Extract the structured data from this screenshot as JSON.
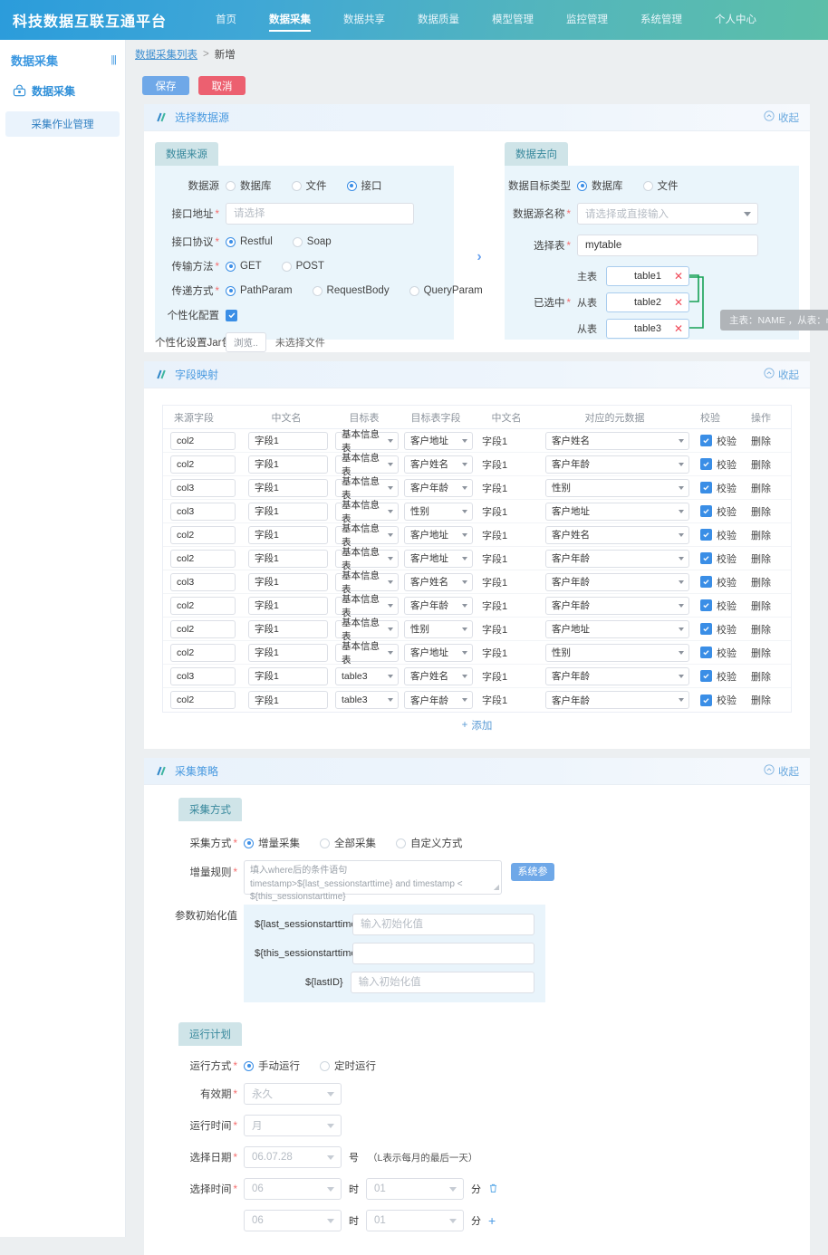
{
  "app": {
    "brand": "科技数据互联互通平台",
    "nav": [
      {
        "label": "首页",
        "active": false
      },
      {
        "label": "数据采集",
        "active": true
      },
      {
        "label": "数据共享",
        "active": false
      },
      {
        "label": "数据质量",
        "active": false
      },
      {
        "label": "模型管理",
        "active": false
      },
      {
        "label": "监控管理",
        "active": false
      },
      {
        "label": "系统管理",
        "active": false
      },
      {
        "label": "个人中心",
        "active": false
      }
    ]
  },
  "sidebar": {
    "title": "数据采集",
    "collapse_icon": "columns-icon",
    "group_label": "数据采集",
    "group_icon": "collect-icon",
    "items": [
      {
        "label": "采集作业管理",
        "active": true
      }
    ]
  },
  "breadcrumb": {
    "link": "数据采集列表",
    "sep": ">",
    "current": "新增"
  },
  "actions": {
    "save": "保存",
    "cancel": "取消"
  },
  "sections": {
    "datasource": {
      "title": "选择数据源",
      "collapse": "收起"
    },
    "mapping": {
      "title": "字段映射",
      "collapse": "收起"
    },
    "strategy": {
      "title": "采集策略",
      "collapse": "收起"
    }
  },
  "source_panel": {
    "tab": "数据来源",
    "datasource_label": "数据源",
    "datasource_options": [
      {
        "label": "数据库",
        "selected": false
      },
      {
        "label": "文件",
        "selected": false
      },
      {
        "label": "接口",
        "selected": true
      }
    ],
    "api_url_label": "接口地址",
    "api_url_placeholder": "请选择",
    "api_url_value": "",
    "protocol_label": "接口协议",
    "protocol_options": [
      {
        "label": "Restful",
        "selected": true
      },
      {
        "label": "Soap",
        "selected": false
      }
    ],
    "method_label": "传输方法",
    "method_options": [
      {
        "label": "GET",
        "selected": true
      },
      {
        "label": "POST",
        "selected": false
      }
    ],
    "transfer_label": "传递方式",
    "transfer_options": [
      {
        "label": "PathParam",
        "selected": true
      },
      {
        "label": "RequestBody",
        "selected": false
      },
      {
        "label": "QueryParam",
        "selected": false
      }
    ],
    "custom_label": "个性化配置",
    "custom_checked": true,
    "jar_label": "个性化设置Jar包",
    "jar_browse": "浏览..",
    "jar_status": "未选择文件"
  },
  "arrow": "›",
  "target_panel": {
    "tab": "数据去向",
    "type_label": "数据目标类型",
    "type_options": [
      {
        "label": "数据库",
        "selected": true
      },
      {
        "label": "文件",
        "selected": false
      }
    ],
    "ds_name_label": "数据源名称",
    "ds_name_placeholder": "请选择或直接输入",
    "ds_name_value": "",
    "table_label": "选择表",
    "table_value": "mytable",
    "selected_label": "已选中",
    "rows": [
      {
        "role": "主表",
        "name": "table1",
        "remove": "✕"
      },
      {
        "role": "从表",
        "name": "table2",
        "remove": "✕"
      },
      {
        "role": "从表",
        "name": "table3",
        "remove": "✕"
      }
    ],
    "tooltip": "主表：NAME ，从表：name",
    "connector_color": "#17a255"
  },
  "mapping_table": {
    "headers": [
      "来源字段",
      "中文名",
      "目标表",
      "目标表字段",
      "中文名",
      "对应的元数据",
      "校验",
      "操作"
    ],
    "verify_label": "校验",
    "delete_label": "删除",
    "add_label": "添加",
    "rows": [
      {
        "src": "col2",
        "cn1": "字段1",
        "tgt_table": "基本信息表",
        "tgt_field": "客户地址",
        "cn2": "字段1",
        "meta": "客户姓名",
        "verify": true
      },
      {
        "src": "col2",
        "cn1": "字段1",
        "tgt_table": "基本信息表",
        "tgt_field": "客户姓名",
        "cn2": "字段1",
        "meta": "客户年龄",
        "verify": true
      },
      {
        "src": "col3",
        "cn1": "字段1",
        "tgt_table": "基本信息表",
        "tgt_field": "客户年龄",
        "cn2": "字段1",
        "meta": "性别",
        "verify": true
      },
      {
        "src": "col3",
        "cn1": "字段1",
        "tgt_table": "基本信息表",
        "tgt_field": "性别",
        "cn2": "字段1",
        "meta": "客户地址",
        "verify": true
      },
      {
        "src": "col2",
        "cn1": "字段1",
        "tgt_table": "基本信息表",
        "tgt_field": "客户地址",
        "cn2": "字段1",
        "meta": "客户姓名",
        "verify": true
      },
      {
        "src": "col2",
        "cn1": "字段1",
        "tgt_table": "基本信息表",
        "tgt_field": "客户地址",
        "cn2": "字段1",
        "meta": "客户年龄",
        "verify": true
      },
      {
        "src": "col3",
        "cn1": "字段1",
        "tgt_table": "基本信息表",
        "tgt_field": "客户姓名",
        "cn2": "字段1",
        "meta": "客户年龄",
        "verify": true
      },
      {
        "src": "col2",
        "cn1": "字段1",
        "tgt_table": "基本信息表",
        "tgt_field": "客户年龄",
        "cn2": "字段1",
        "meta": "客户年龄",
        "verify": true
      },
      {
        "src": "col2",
        "cn1": "字段1",
        "tgt_table": "基本信息表",
        "tgt_field": "性别",
        "cn2": "字段1",
        "meta": "客户地址",
        "verify": true
      },
      {
        "src": "col2",
        "cn1": "字段1",
        "tgt_table": "基本信息表",
        "tgt_field": "客户地址",
        "cn2": "字段1",
        "meta": "性别",
        "verify": true
      },
      {
        "src": "col3",
        "cn1": "字段1",
        "tgt_table": "table3",
        "tgt_field": "客户姓名",
        "cn2": "字段1",
        "meta": "客户年龄",
        "verify": true
      },
      {
        "src": "col2",
        "cn1": "字段1",
        "tgt_table": "table3",
        "tgt_field": "客户年龄",
        "cn2": "字段1",
        "meta": "客户年龄",
        "verify": true
      }
    ]
  },
  "strategy": {
    "tab": "采集方式",
    "mode_label": "采集方式",
    "mode_options": [
      {
        "label": "增量采集",
        "selected": true
      },
      {
        "label": "全部采集",
        "selected": false
      },
      {
        "label": "自定义方式",
        "selected": false
      }
    ],
    "rule_label": "增量规则",
    "rule_line1": "填入where后的条件语句",
    "rule_line2": "timestamp>${last_sessionstarttime} and timestamp  <  ${this_sessionstarttime}",
    "sys_param_btn": "系统参数",
    "params_label": "参数初始化值",
    "params": [
      {
        "name": "${last_sessionstarttime}",
        "placeholder": "输入初始化值",
        "value": ""
      },
      {
        "name": "${this_sessionstarttime}",
        "placeholder": "",
        "value": ""
      },
      {
        "name": "${lastID}",
        "placeholder": "输入初始化值",
        "value": ""
      }
    ]
  },
  "plan": {
    "tab": "运行计划",
    "run_mode_label": "运行方式",
    "run_mode_options": [
      {
        "label": "手动运行",
        "selected": true
      },
      {
        "label": "定时运行",
        "selected": false
      }
    ],
    "validity_label": "有效期",
    "validity_value": "永久",
    "run_time_label": "运行时间",
    "run_time_value": "月",
    "date_label": "选择日期",
    "date_value": "06.07.28",
    "date_unit": "号",
    "date_hint": "（L表示每月的最后一天）",
    "time_label": "选择时间",
    "hour_unit": "时",
    "minute_unit": "分",
    "time_rows": [
      {
        "hour": "06",
        "minute": "01",
        "action": "delete"
      },
      {
        "hour": "06",
        "minute": "01",
        "action": "add"
      }
    ]
  }
}
